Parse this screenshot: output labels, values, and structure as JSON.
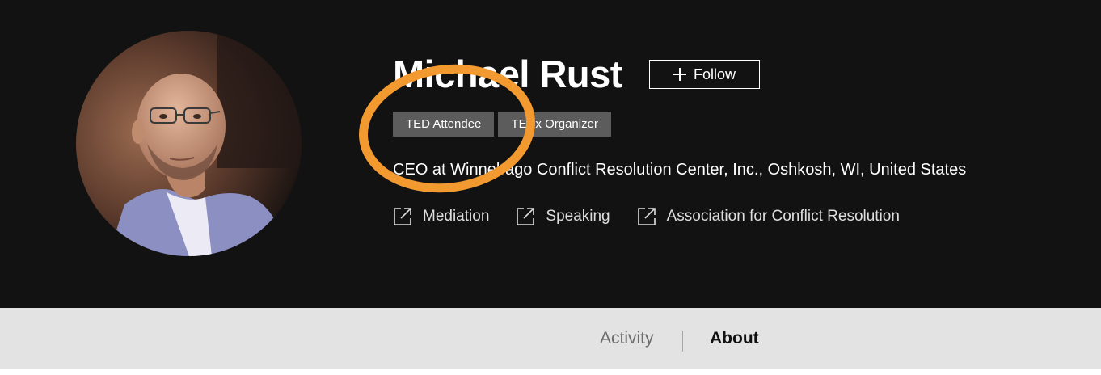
{
  "profile": {
    "name": "Michael Rust",
    "follow_label": "Follow",
    "badges": [
      "TED Attendee",
      "TEDx Organizer"
    ],
    "bio": "CEO at Winnebago Conflict Resolution Center, Inc., Oshkosh, WI, United States",
    "links": [
      {
        "label": "Mediation",
        "icon": "external-link-icon"
      },
      {
        "label": "Speaking",
        "icon": "external-link-icon"
      },
      {
        "label": "Association for Conflict Resolution",
        "icon": "external-link-icon"
      }
    ]
  },
  "annotation": {
    "shape": "circle",
    "color": "#f29a30"
  },
  "tabs": [
    {
      "label": "Activity",
      "active": false
    },
    {
      "label": "About",
      "active": true
    }
  ],
  "colors": {
    "hero_bg": "#121212",
    "tab_bar_bg": "#e3e3e3",
    "badge_bg": "#5c5c5c"
  }
}
